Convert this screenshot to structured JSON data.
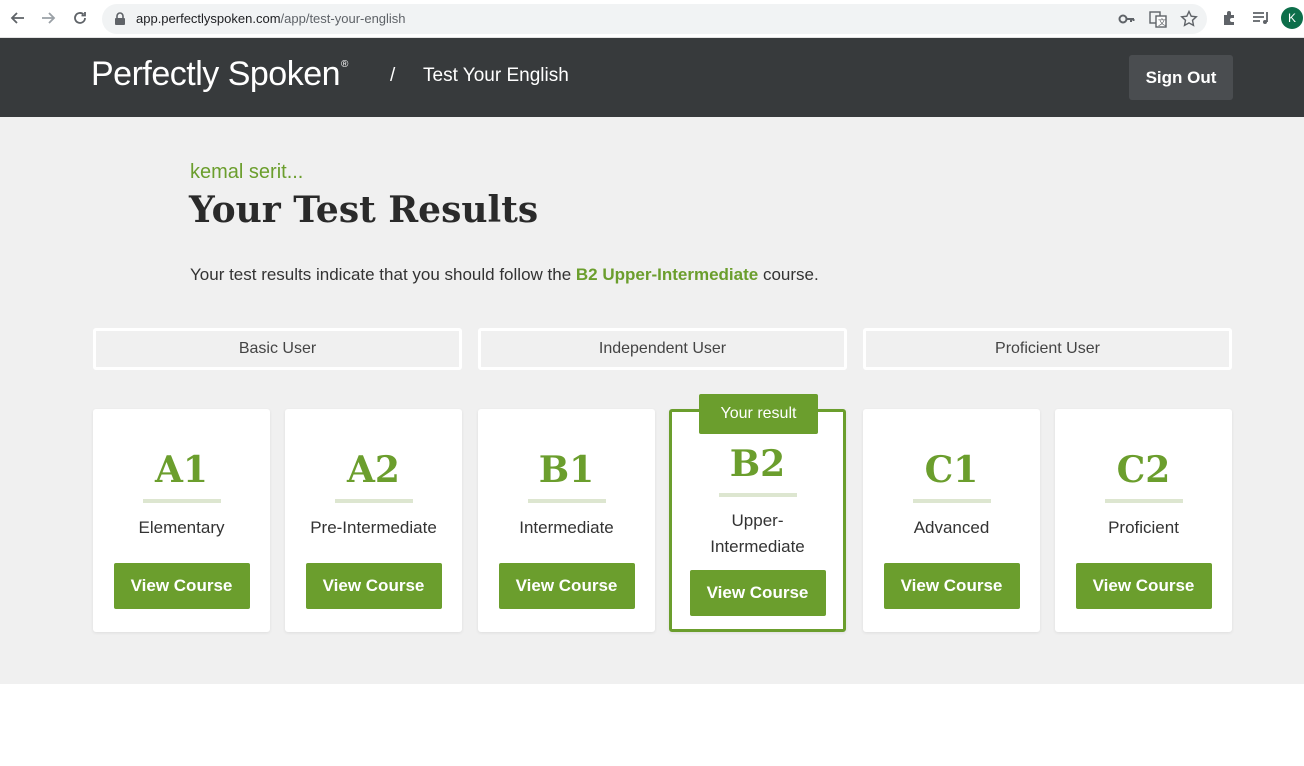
{
  "browser": {
    "url_domain": "app.perfectlyspoken.com",
    "url_path": "/app/test-your-english",
    "avatar_initial": "K"
  },
  "header": {
    "logo_text": "Perfectly Spoken",
    "logo_mark": "®",
    "breadcrumb_sep": "/",
    "breadcrumb_page": "Test Your English",
    "signout_label": "Sign Out"
  },
  "main": {
    "user_name": "kemal serit...",
    "title": "Your Test Results",
    "result_prefix": "Your test results indicate that you should follow the",
    "result_course": "B2 Upper-Intermediate",
    "result_suffix": "course.",
    "groups": [
      "Basic User",
      "Independent User",
      "Proficient User"
    ],
    "badge_label": "Your result",
    "levels": [
      {
        "code": "A1",
        "name": "Elementary",
        "button": "View Course"
      },
      {
        "code": "A2",
        "name": "Pre-Intermediate",
        "button": "View Course"
      },
      {
        "code": "B1",
        "name": "Intermediate",
        "button": "View Course"
      },
      {
        "code": "B2",
        "name": "Upper-Intermediate",
        "button": "View Course"
      },
      {
        "code": "C1",
        "name": "Advanced",
        "button": "View Course"
      },
      {
        "code": "C2",
        "name": "Proficient",
        "button": "View Course"
      }
    ]
  },
  "colors": {
    "accent": "#6b9e2d",
    "header_bg": "#373a3c",
    "content_bg": "#f0f0f0"
  }
}
